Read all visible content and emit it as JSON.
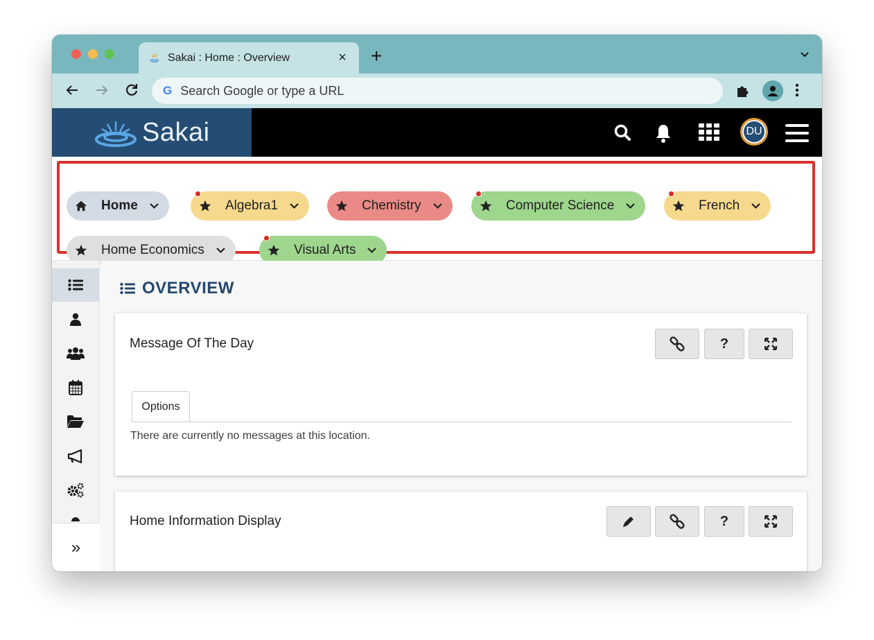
{
  "browser": {
    "tab_title": "Sakai : Home : Overview",
    "tab_close": "×",
    "new_tab": "+",
    "address_placeholder": "Search Google or type a URL",
    "google_letter": "G"
  },
  "header": {
    "logo_text": "Sakai",
    "avatar_initials": "DU"
  },
  "sites": [
    {
      "label": "Home",
      "color": "#d2dbe3",
      "bold": true,
      "icon": "home-icon",
      "dot": false
    },
    {
      "label": "Algebra1",
      "color": "#f7d98e",
      "icon": "star-icon",
      "dot": true
    },
    {
      "label": "Chemistry",
      "color": "#ea8a86",
      "icon": "star-icon",
      "dot": false
    },
    {
      "label": "Computer Science",
      "color": "#9dd68c",
      "icon": "star-icon",
      "dot": true
    },
    {
      "label": "French",
      "color": "#f7d98e",
      "icon": "star-icon",
      "dot": true
    },
    {
      "label": "Home Economics",
      "color": "#dfdfdf",
      "icon": "star-icon",
      "dot": false
    },
    {
      "label": "Visual Arts",
      "color": "#9dd68c",
      "icon": "star-icon",
      "dot": true
    }
  ],
  "tool_rail": {
    "items": [
      "overview-icon",
      "profile-icon",
      "roster-icon",
      "calendar-icon",
      "resources-icon",
      "announcements-icon",
      "site-info-icon",
      "more-tools-icon"
    ],
    "expand_label": "»"
  },
  "main": {
    "page_title": "OVERVIEW",
    "cards": [
      {
        "title": "Message Of The Day",
        "buttons": [
          "link-icon",
          "help-icon",
          "maximize-icon"
        ],
        "tab_label": "Options",
        "empty_message": "There are currently no messages at this location."
      },
      {
        "title": "Home Information Display",
        "buttons": [
          "edit-icon",
          "link-icon",
          "help-icon",
          "maximize-icon"
        ]
      }
    ],
    "help_glyph": "?"
  }
}
